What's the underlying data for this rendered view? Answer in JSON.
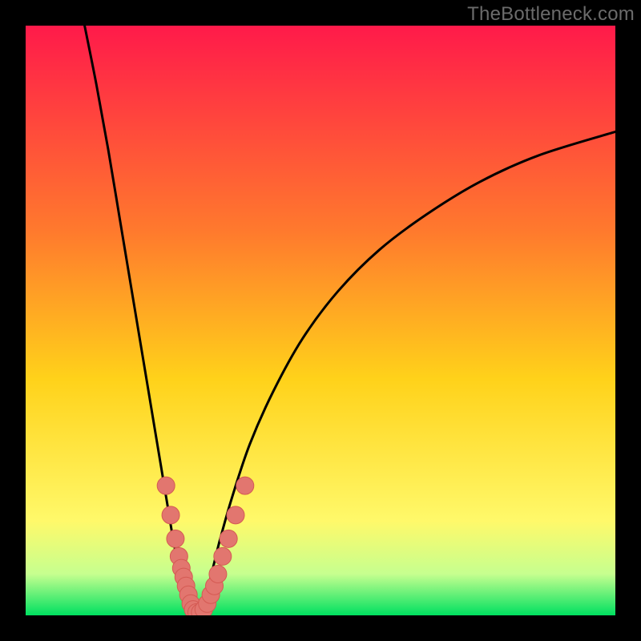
{
  "watermark": "TheBottleneck.com",
  "colors": {
    "frame": "#000000",
    "gradient_top": "#ff1a4a",
    "gradient_mid_upper": "#ff7a2d",
    "gradient_mid": "#ffd21a",
    "gradient_lower": "#fff96a",
    "gradient_green_pale": "#c6ff8f",
    "gradient_green": "#00e060",
    "curve": "#000000",
    "marker_fill": "#e2766f",
    "marker_stroke": "#d45a53"
  },
  "chart_data": {
    "type": "line",
    "title": "",
    "xlabel": "",
    "ylabel": "",
    "xlim": [
      0,
      100
    ],
    "ylim": [
      0,
      100
    ],
    "series": [
      {
        "name": "bottleneck-curve-left",
        "x": [
          10,
          12,
          14,
          16,
          18,
          20,
          22,
          24,
          25,
          26,
          27,
          27.8,
          28.4,
          29
        ],
        "y": [
          100,
          90,
          79,
          67,
          55,
          43,
          31,
          19,
          13,
          8,
          4.5,
          2,
          0.8,
          0
        ]
      },
      {
        "name": "bottleneck-curve-right",
        "x": [
          29,
          30,
          31,
          32,
          33,
          35,
          38,
          42,
          47,
          53,
          60,
          68,
          77,
          87,
          100
        ],
        "y": [
          0,
          2,
          5,
          9,
          13,
          20,
          29,
          38,
          47,
          55,
          62,
          68,
          73.5,
          78,
          82
        ]
      }
    ],
    "markers": {
      "name": "sample-points",
      "points": [
        {
          "x": 23.8,
          "y": 22
        },
        {
          "x": 24.6,
          "y": 17
        },
        {
          "x": 25.4,
          "y": 13
        },
        {
          "x": 26.0,
          "y": 10
        },
        {
          "x": 26.4,
          "y": 8
        },
        {
          "x": 26.8,
          "y": 6.5
        },
        {
          "x": 27.2,
          "y": 5
        },
        {
          "x": 27.6,
          "y": 3.5
        },
        {
          "x": 28.0,
          "y": 2
        },
        {
          "x": 28.4,
          "y": 1
        },
        {
          "x": 29.0,
          "y": 0.5
        },
        {
          "x": 29.6,
          "y": 0.5
        },
        {
          "x": 30.2,
          "y": 1
        },
        {
          "x": 30.8,
          "y": 2
        },
        {
          "x": 31.4,
          "y": 3.5
        },
        {
          "x": 32.0,
          "y": 5
        },
        {
          "x": 32.6,
          "y": 7
        },
        {
          "x": 33.4,
          "y": 10
        },
        {
          "x": 34.4,
          "y": 13
        },
        {
          "x": 35.6,
          "y": 17
        },
        {
          "x": 37.2,
          "y": 22
        }
      ]
    }
  }
}
